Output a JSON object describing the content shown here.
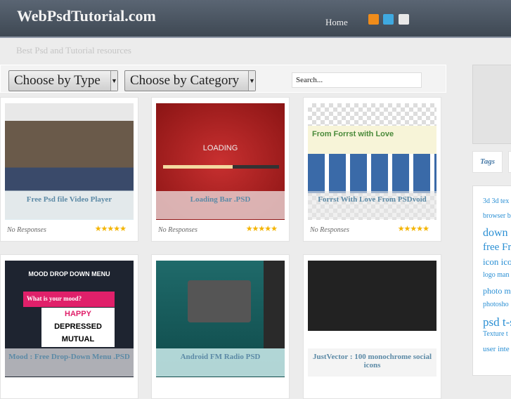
{
  "header": {
    "logo": "WebPsdTutorial.com",
    "nav_home": "Home",
    "tagline": "Best Psd and Tutorial resources",
    "social_icons": [
      "rss-icon",
      "twitter-icon",
      "email-icon"
    ]
  },
  "filters": {
    "type": "Choose by Type",
    "category": "Choose by Category",
    "search_value": "Search..."
  },
  "cards": [
    {
      "title": "Free Psd file Video Player",
      "responses": "No Responses",
      "rating": 5
    },
    {
      "title": "Loading Bar .PSD",
      "responses": "No Responses",
      "rating": 5
    },
    {
      "title": "Forrst With Love From PSDvoid",
      "responses": "No Responses",
      "rating": 5
    },
    {
      "title": "Mood : Free Drop-Down Menu .PSD"
    },
    {
      "title": "Android FM Radio PSD"
    },
    {
      "title": "JustVector : 100 monochrome social icons"
    }
  ],
  "thumb_text": {
    "loading": "LOADING",
    "forrst": "From Forrst with Love",
    "mood_header": "MOOD DROP DOWN MENU",
    "mood_q": "What is your mood?",
    "mood_1": "HAPPY",
    "mood_2": "DEPRESSED",
    "mood_3": "MUTUAL"
  },
  "sidebar": {
    "tab_tags": "Tags",
    "tags": [
      "3d 3d tex",
      "browser b",
      "down",
      "free Fre",
      "icon ico",
      "logo man",
      "photo m",
      "photosho",
      "psd t-s",
      "Texture t",
      "user inte"
    ]
  },
  "colors": {
    "accent": "#2a8fd4",
    "header": "#4a5461"
  }
}
